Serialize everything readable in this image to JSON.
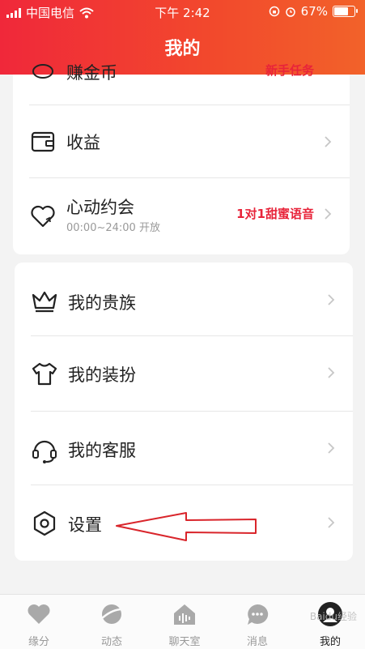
{
  "status_bar": {
    "carrier": "中国电信",
    "time": "下午 2:42",
    "battery": "67%",
    "battery_level": 0.67
  },
  "header": {
    "title": "我的"
  },
  "card1": {
    "partial_label": "赚金币",
    "partial_promo": "新手任务",
    "items": [
      {
        "label": "收益"
      },
      {
        "label": "心动约会",
        "sub": "00:00~24:00 开放",
        "promo": "1对1甜蜜语音"
      }
    ]
  },
  "card2": {
    "items": [
      {
        "label": "我的贵族",
        "icon": "crown-icon"
      },
      {
        "label": "我的装扮",
        "icon": "tshirt-icon"
      },
      {
        "label": "我的客服",
        "icon": "headset-icon"
      },
      {
        "label": "设置",
        "icon": "settings-icon"
      }
    ]
  },
  "tabbar": {
    "tabs": [
      {
        "label": "缘分",
        "icon": "heart-icon"
      },
      {
        "label": "动态",
        "icon": "planet-icon"
      },
      {
        "label": "聊天室",
        "icon": "house-audio-icon"
      },
      {
        "label": "消息",
        "icon": "chat-bubble-icon"
      },
      {
        "label": "我的",
        "icon": "avatar-icon",
        "active": true
      }
    ]
  },
  "watermark": "Baidu经验",
  "colors": {
    "brand": "#f0283a",
    "promo": "#e8243a",
    "annotation_arrow": "#d9252b"
  }
}
